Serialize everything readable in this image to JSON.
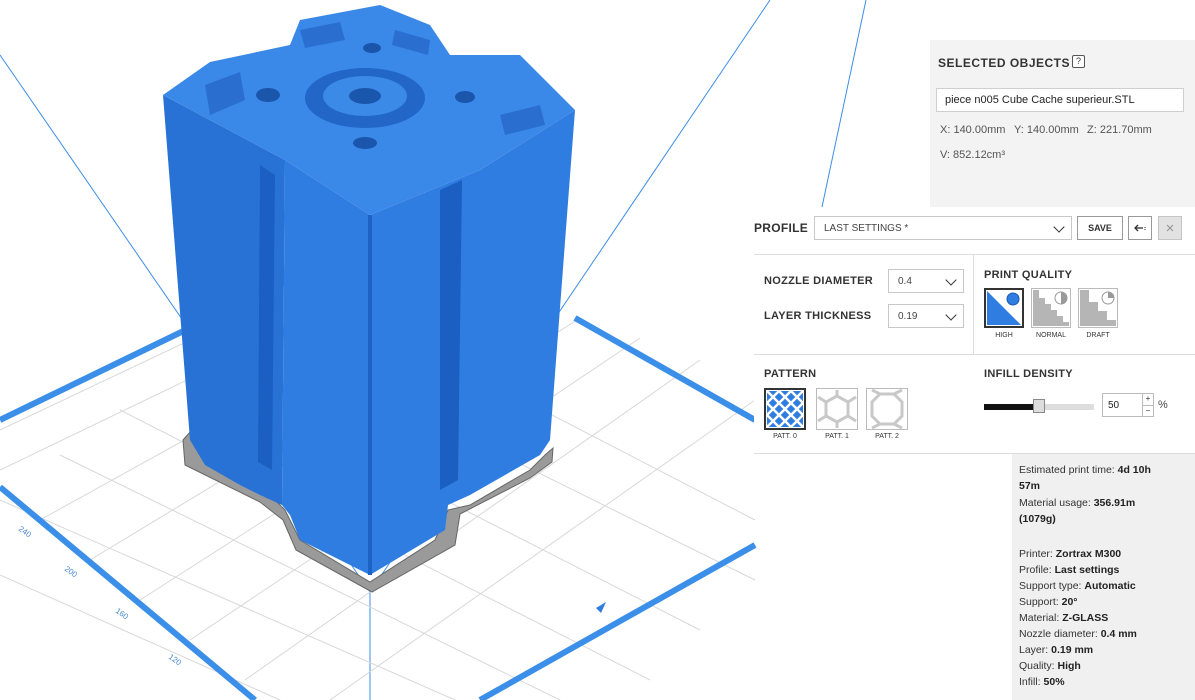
{
  "selected_objects": {
    "title": "SELECTED OBJECTS",
    "help": "?",
    "object_name": "piece n005 Cube Cache superieur.STL",
    "x": "X: 140.00mm",
    "y": "Y: 140.00mm",
    "z": "Z: 221.70mm",
    "v": "V: 852.12cm³"
  },
  "profile": {
    "label": "PROFILE",
    "selected": "LAST SETTINGS *",
    "save_label": "SAVE",
    "nozzle_label": "NOZZLE DIAMETER",
    "nozzle_value": "0.4",
    "layer_label": "LAYER THICKNESS",
    "layer_value": "0.19",
    "quality_label": "PRINT QUALITY",
    "quality_options": [
      "HIGH",
      "NORMAL",
      "DRAFT"
    ],
    "quality_selected": "HIGH",
    "pattern_label": "PATTERN",
    "pattern_options": [
      "PATT. 0",
      "PATT. 1",
      "PATT. 2"
    ],
    "pattern_selected": "PATT. 0",
    "infill_label": "INFILL DENSITY",
    "infill_value": "50",
    "infill_fraction": 0.5,
    "infill_unit": "%",
    "spin_up": "+",
    "spin_down": "−"
  },
  "summary": {
    "print_time_label": "Estimated print time: ",
    "print_time_value": "4d 10h",
    "print_time_value2": "57m",
    "material_usage_label": "Material usage: ",
    "material_usage_value": "356.91m",
    "material_usage_value2": "(1079g)",
    "printer_label": "Printer: ",
    "printer_value": "Zortrax M300",
    "profile_label": "Profile: ",
    "profile_value": "Last settings",
    "support_type_label": "Support type: ",
    "support_type_value": "Automatic",
    "support_label": "Support: ",
    "support_value": "20°",
    "material_label": "Material: ",
    "material_value": "Z-GLASS",
    "nozzle_label": "Nozzle diameter: ",
    "nozzle_value": "0.4 mm",
    "layer_label": "Layer: ",
    "layer_value": "0.19 mm",
    "quality_label": "Quality: ",
    "quality_value": "High",
    "infill_label": "Infill: ",
    "infill_value": "50%"
  },
  "axis_labels": [
    "240",
    "200",
    "160",
    "120"
  ],
  "colors": {
    "model": "#2f7de1",
    "model_dark": "#1c5fc2",
    "platform_edge": "#3b8fe8",
    "grid_line": "#d6d6d6",
    "guide_line": "#3d8ee6"
  }
}
